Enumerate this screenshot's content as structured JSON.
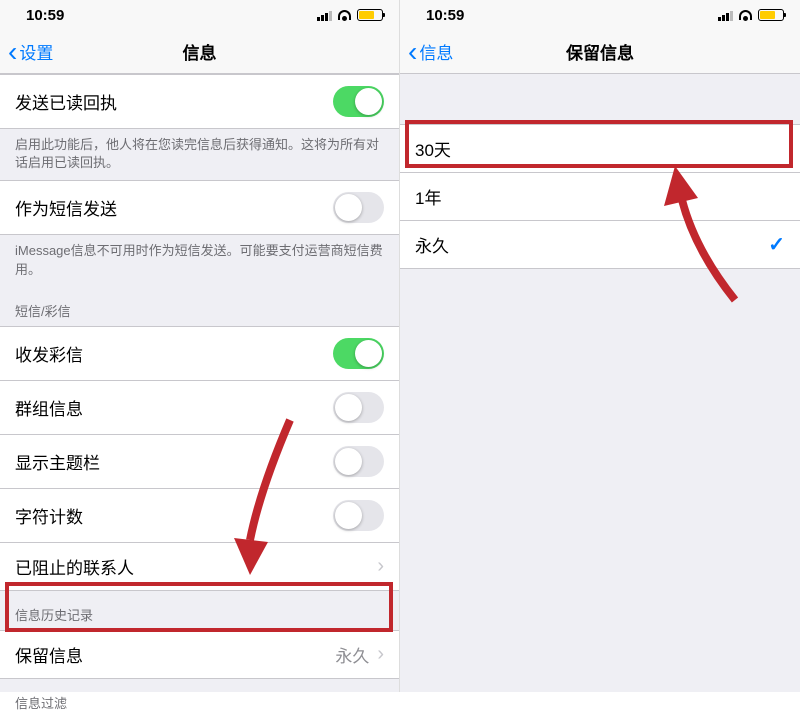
{
  "left": {
    "status": {
      "time": "10:59"
    },
    "nav": {
      "back": "设置",
      "title": "信息"
    },
    "rows": {
      "read_receipt": {
        "label": "发送已读回执",
        "on": true
      },
      "read_receipt_footer": "启用此功能后，他人将在您读完信息后获得通知。这将为所有对话启用已读回执。",
      "send_as_sms": {
        "label": "作为短信发送",
        "on": false
      },
      "send_as_sms_footer": "iMessage信息不可用时作为短信发送。可能要支付运营商短信费用。",
      "sms_mms_header": "短信/彩信",
      "mms": {
        "label": "收发彩信",
        "on": true
      },
      "group": {
        "label": "群组信息",
        "on": false
      },
      "subject": {
        "label": "显示主题栏",
        "on": false
      },
      "char_count": {
        "label": "字符计数",
        "on": false
      },
      "blocked": {
        "label": "已阻止的联系人"
      },
      "history_header": "信息历史记录",
      "keep": {
        "label": "保留信息",
        "value": "永久"
      },
      "filter_header": "信息过滤"
    }
  },
  "right": {
    "status": {
      "time": "10:59"
    },
    "nav": {
      "back": "信息",
      "title": "保留信息"
    },
    "options": {
      "opt30": {
        "label": "30天",
        "selected": false
      },
      "opt1y": {
        "label": "1年",
        "selected": false
      },
      "optForever": {
        "label": "永久",
        "selected": true
      }
    }
  }
}
